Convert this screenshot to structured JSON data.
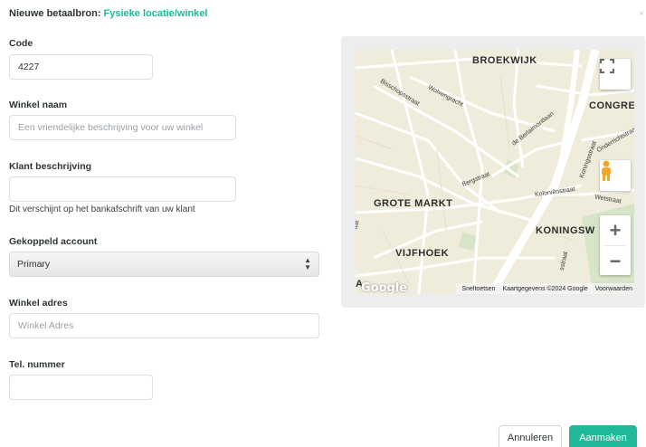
{
  "header": {
    "prefix": "Nieuwe betaalbron:",
    "type": "Fysieke locatie/winkel",
    "close": "×"
  },
  "form": {
    "code": {
      "label": "Code",
      "value": "4227"
    },
    "shop_name": {
      "label": "Winkel naam",
      "placeholder": "Een vriendelijke beschrijving voor uw winkel"
    },
    "client_desc": {
      "label": "Klant beschrijving",
      "value": "",
      "help": "Dit verschijnt op het bankafschrift van uw klant"
    },
    "account": {
      "label": "Gekoppeld account",
      "selected": "Primary"
    },
    "address": {
      "label": "Winkel adres",
      "placeholder": "Winkel Adres"
    },
    "phone": {
      "label": "Tel. nummer",
      "value": ""
    }
  },
  "map": {
    "districts": [
      "BROEKWIJK",
      "CONGRE",
      "GROTE MARKT",
      "KONINGSW",
      "VIJFHOEK",
      "A"
    ],
    "streets": [
      "Bisschopsstraat",
      "Wolvengracht",
      "de Berlaimontlaan",
      "Bergstraat",
      "Koloniënstraat",
      "Koningsstraat",
      "Wetstraat",
      "Onderrichtstraat",
      "aat",
      "sstraat"
    ],
    "controls": {
      "fullscreen": "⛶",
      "zoom_in": "+",
      "zoom_out": "−"
    },
    "attribution": {
      "logo": "Google",
      "shortcuts": "Sneltoetsen",
      "map_data": "Kaartgegevens ©2024 Google",
      "terms": "Voorwaarden"
    }
  },
  "actions": {
    "cancel": "Annuleren",
    "create": "Aanmaken"
  },
  "colors": {
    "accent": "#1fb99a",
    "map_bg": "#f0ecdb",
    "park": "#d6e5c8"
  }
}
